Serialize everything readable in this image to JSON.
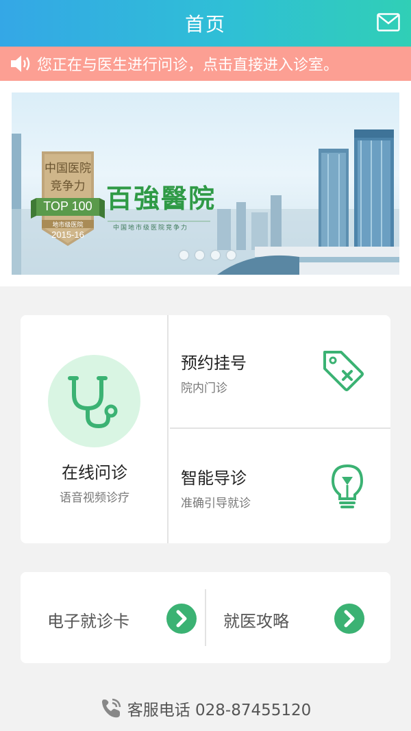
{
  "header": {
    "title": "首页",
    "mail_icon": "mail-icon"
  },
  "notice": {
    "icon": "speaker-icon",
    "text": "您正在与医生进行问诊，点击直接进入诊室。"
  },
  "banner": {
    "badge_line1": "中国医院",
    "badge_line2": "竞争力",
    "badge_rank": "TOP 100",
    "badge_small": "地市级医院",
    "badge_year": "2015-16",
    "headline": "百強醫院",
    "subline": "中国地市级医院竞争力",
    "slides": 4,
    "active_slide": 1
  },
  "services": {
    "online": {
      "title": "在线问诊",
      "subtitle": "语音视频诊疗",
      "icon": "stethoscope-icon"
    },
    "appointment": {
      "title": "预约挂号",
      "subtitle": "院内门诊",
      "icon": "tag-icon"
    },
    "guide": {
      "title": "智能导诊",
      "subtitle": "准确引导就诊",
      "icon": "lightbulb-icon"
    }
  },
  "links": {
    "card": {
      "label": "电子就诊卡",
      "icon": "chevron-right-icon"
    },
    "guide": {
      "label": "就医攻略",
      "icon": "chevron-right-icon"
    }
  },
  "footer": {
    "text": "客服电话 028-87455120",
    "icon": "phone-icon"
  },
  "colors": {
    "accent": "#3bb273",
    "notice_bg": "#fc9f93",
    "header_start": "#34a7e6",
    "header_end": "#30cfb6"
  }
}
